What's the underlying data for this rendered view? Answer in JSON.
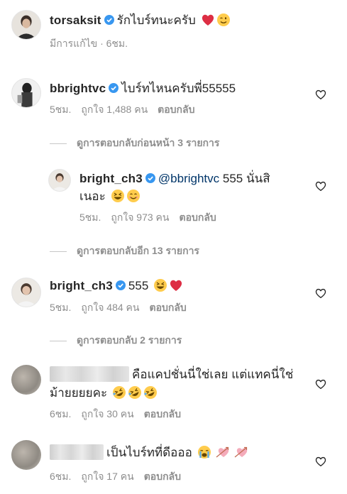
{
  "post": {
    "username": "torsaksit",
    "caption": "รักไบร์ทนะครับ",
    "meta": "มีการแก้ไข · 6ชม."
  },
  "comments": [
    {
      "username": "bbrightvc",
      "text": "ไบร์ทไหนครับพี่55555",
      "time": "5ชม.",
      "likes": "ถูกใจ 1,488 คน",
      "reply": "ตอบกลับ"
    },
    {
      "view_previous": "ดูการตอบกลับก่อนหน้า 3 รายการ"
    },
    {
      "username": "bright_ch3",
      "mention": "@bbrightvc",
      "text_line1": " 555 นั่นสิ",
      "text_line2": "เนอะ",
      "time": "5ชม.",
      "likes": "ถูกใจ 973 คน",
      "reply": "ตอบกลับ",
      "view_more": "ดูการตอบกลับอีก 13 รายการ"
    },
    {
      "username": "bright_ch3",
      "text": "555",
      "time": "5ชม.",
      "likes": "ถูกใจ 484 คน",
      "reply": "ตอบกลับ",
      "view_replies": "ดูการตอบกลับ 2 รายการ"
    },
    {
      "text_line1": "คือแคปชั่นนี่ใช่เลย แต่แทคนี่ใช่",
      "text_line2": "ม้ายยยยคะ",
      "time": "6ชม.",
      "likes": "ถูกใจ 30 คน",
      "reply": "ตอบกลับ"
    },
    {
      "text": "เป็นไบร์ทที่ดีอออ",
      "time": "6ชม.",
      "likes": "ถูกใจ 17 คน",
      "reply": "ตอบกลับ"
    }
  ],
  "icons": {
    "verified": "verified-badge-icon",
    "like": "heart-outline-icon",
    "red_heart": "red-heart-emoji",
    "wink": "winking-face-emoji",
    "laugh": "grinning-squinting-face-emoji",
    "smile": "smiling-face-emoji",
    "rofl": "rolling-on-floor-laughing-emoji",
    "cry": "loudly-crying-face-emoji",
    "pink_hearts": "heart-with-arrow-emoji"
  },
  "colors": {
    "verified_blue": "#3897f0",
    "text": "#262626",
    "meta_gray": "#8e8e8e",
    "heart_red": "#ed4956"
  }
}
